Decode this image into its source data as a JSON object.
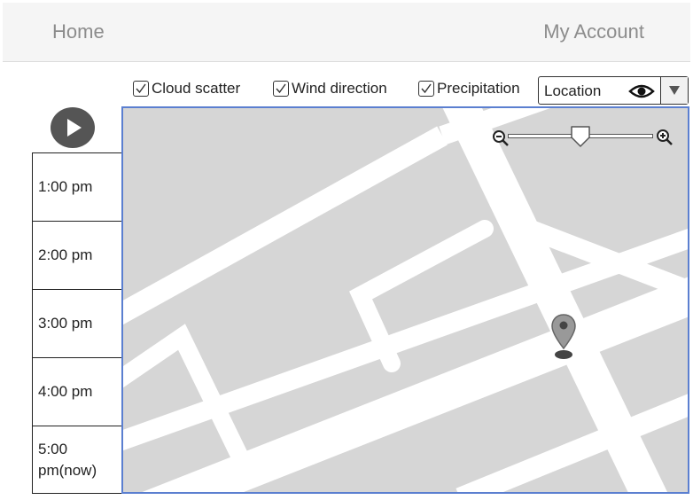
{
  "nav": {
    "home_label": "Home",
    "account_label": "My Account"
  },
  "layers": [
    {
      "label": "Cloud scatter",
      "checked": true
    },
    {
      "label": "Wind direction",
      "checked": true
    },
    {
      "label": "Precipitation",
      "checked": true
    }
  ],
  "location": {
    "value": "Location"
  },
  "timeline": {
    "slots": [
      "1:00 pm",
      "2:00 pm",
      "3:00 pm",
      "4:00 pm",
      "5:00 pm(now)"
    ]
  },
  "map": {
    "zoom_level": 0.5
  },
  "icons": [
    "play-icon",
    "checkmark-icon",
    "eye-icon",
    "chevron-down-icon",
    "zoom-out-icon",
    "zoom-in-icon",
    "map-pin-icon"
  ],
  "colors": {
    "map_border": "#5b7fd0",
    "map_background": "#d6d6d6",
    "roads": "#ffffff",
    "play_button": "#555555"
  }
}
